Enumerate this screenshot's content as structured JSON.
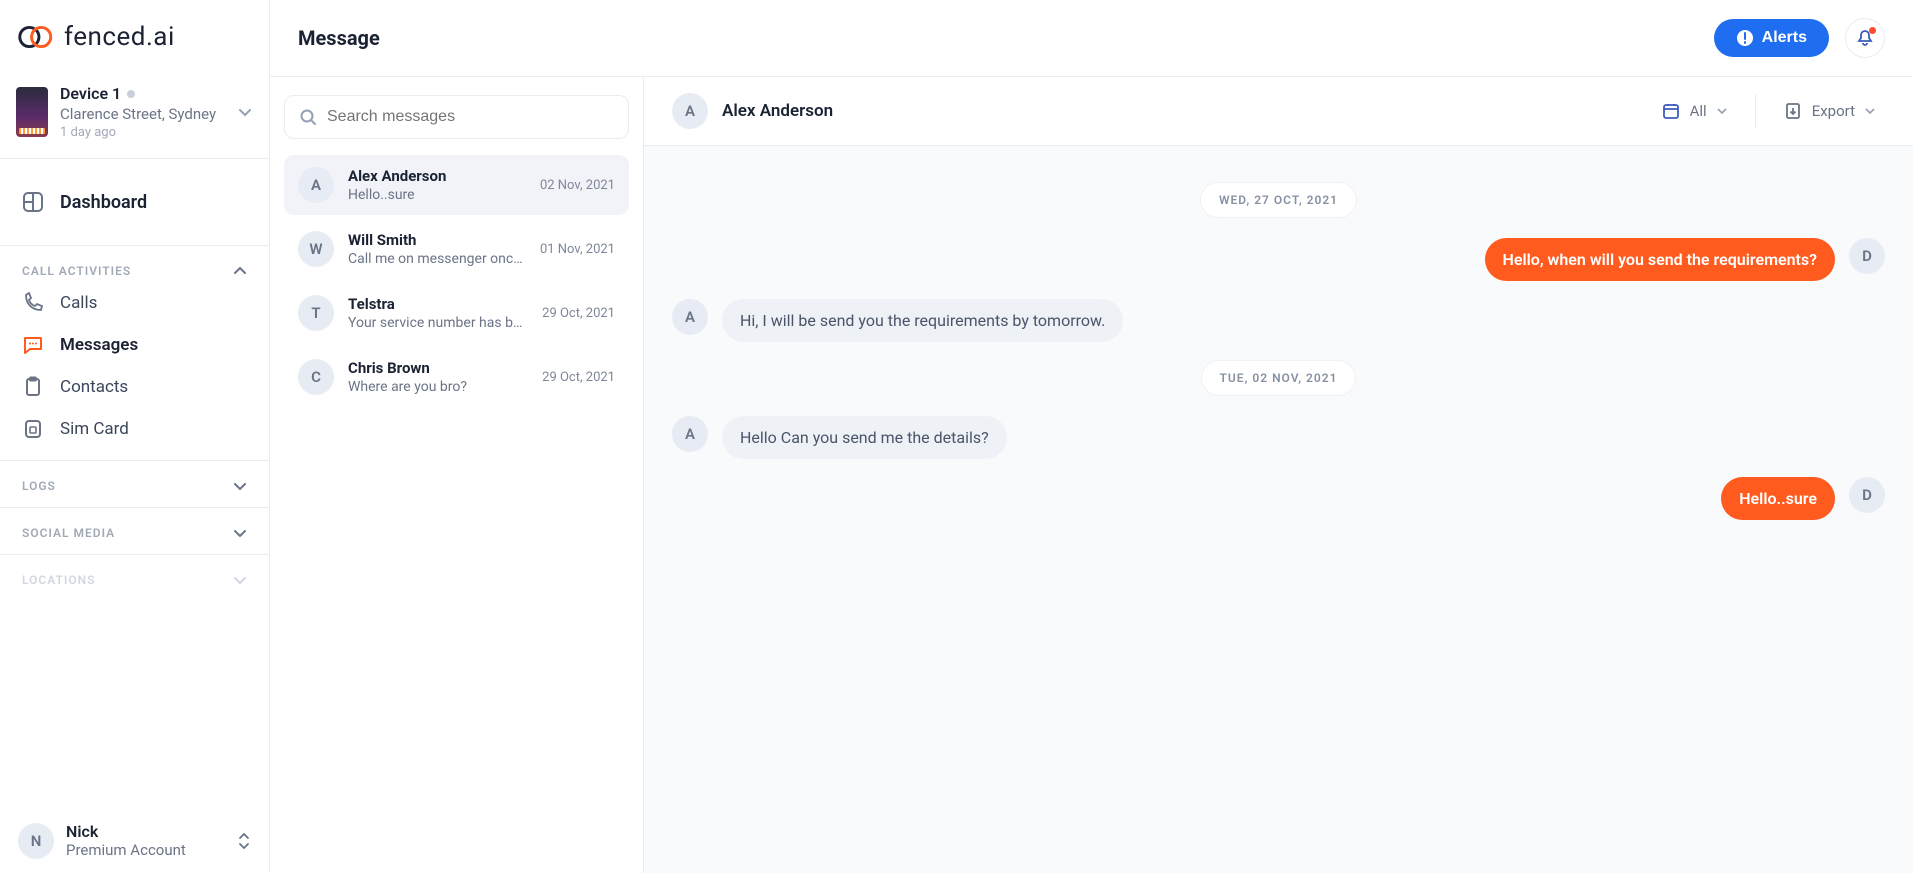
{
  "brand": {
    "name": "fenced.ai"
  },
  "device": {
    "title": "Device 1",
    "location": "Clarence Street, Sydney",
    "time": "1 day ago"
  },
  "nav": {
    "dashboard": "Dashboard",
    "sections": {
      "call_activities": "CALL ACTIVITIES",
      "logs": "LOGS",
      "social_media": "SOCIAL MEDIA",
      "locations": "LOCATIONS"
    },
    "items": {
      "calls": "Calls",
      "messages": "Messages",
      "contacts": "Contacts",
      "sim": "Sim Card"
    }
  },
  "user": {
    "initial": "N",
    "name": "Nick",
    "plan": "Premium Account"
  },
  "page": {
    "title": "Message"
  },
  "actions": {
    "alerts": "Alerts",
    "filter_all": "All",
    "export": "Export"
  },
  "search": {
    "placeholder": "Search messages"
  },
  "threads": [
    {
      "initial": "A",
      "name": "Alex Anderson",
      "preview": "Hello..sure",
      "date": "02 Nov, 2021"
    },
    {
      "initial": "W",
      "name": "Will Smith",
      "preview": "Call me on messenger once you re…",
      "date": "01 Nov, 2021"
    },
    {
      "initial": "T",
      "name": "Telstra",
      "preview": "Your service number has been bloc…",
      "date": "29 Oct, 2021"
    },
    {
      "initial": "C",
      "name": "Chris Brown",
      "preview": "Where are you bro?",
      "date": "29 Oct, 2021"
    }
  ],
  "chat": {
    "contact_initial": "A",
    "contact_name": "Alex Anderson",
    "dates": {
      "d1": "WED, 27 OCT, 2021",
      "d2": "TUE, 02 NOV, 2021"
    },
    "messages": {
      "m1": {
        "from": "D",
        "text": "Hello, when will you send the requirements?"
      },
      "m2": {
        "from": "A",
        "text": "Hi, I will be send you the requirements by tomorrow."
      },
      "m3": {
        "from": "A",
        "text": "Hello Can you send me the details?"
      },
      "m4": {
        "from": "D",
        "text": "Hello..sure"
      }
    }
  }
}
